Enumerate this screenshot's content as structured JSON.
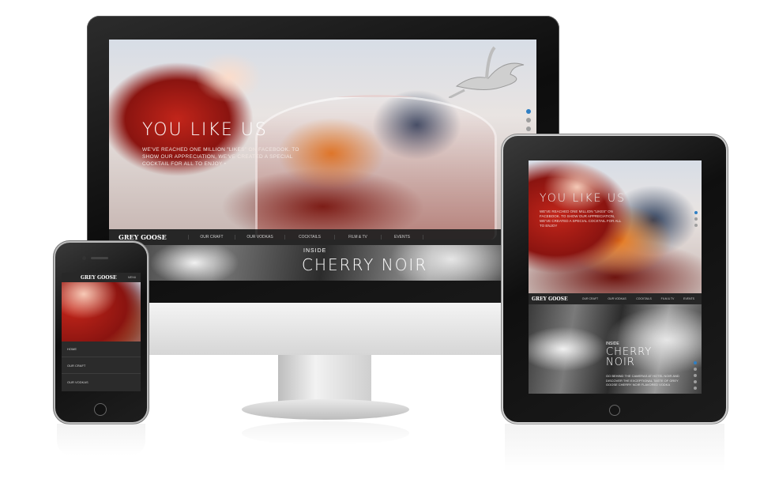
{
  "desktop": {
    "hero_title": "YOU LIKE US",
    "hero_body": "WE'VE REACHED ONE MILLION \"LIKES\" ON FACEBOOK. TO SHOW OUR APPRECIATION, WE'VE CREATED A SPECIAL COCKTAIL FOR ALL TO ENJOY •",
    "logo": "GREY GOOSE",
    "nav": [
      "OUR CRAFT",
      "OUR VODKAS",
      "COCKTAILS",
      "FILM & TV",
      "EVENTS"
    ],
    "feature_kicker": "INSIDE",
    "feature_title": "CHERRY NOIR",
    "slider_dots": 3,
    "active_dot": 0
  },
  "tablet": {
    "hero_title": "YOU LIKE US",
    "hero_body": "WE'VE REACHED ONE MILLION \"LIKES\" ON FACEBOOK. TO SHOW OUR APPRECIATION, WE'VE CREATED A SPECIAL COCKTAIL FOR ALL TO ENJOY",
    "logo": "GREY GOOSE",
    "nav": [
      "OUR CRAFT",
      "OUR VODKAS",
      "COCKTAILS",
      "FILM & TV",
      "EVENTS"
    ],
    "feature_kicker": "INSIDE",
    "feature_title_line1": "CHERRY",
    "feature_title_line2": "NOIR",
    "feature_body": "GO BEHIND THE CAMERAS AT HOTEL NOIR AND DISCOVER THE EXCEPTIONAL TASTE OF GREY GOOSE CHERRY NOIR FLAVORED VODKA"
  },
  "phone": {
    "logo": "GREY GOOSE",
    "menu_label": "MENU",
    "menu": [
      "HOME",
      "OUR CRAFT",
      "OUR VODKAS"
    ]
  },
  "colors": {
    "accent": "#2f7fc4",
    "nav_bg": "#282828",
    "device_black": "#111111"
  }
}
